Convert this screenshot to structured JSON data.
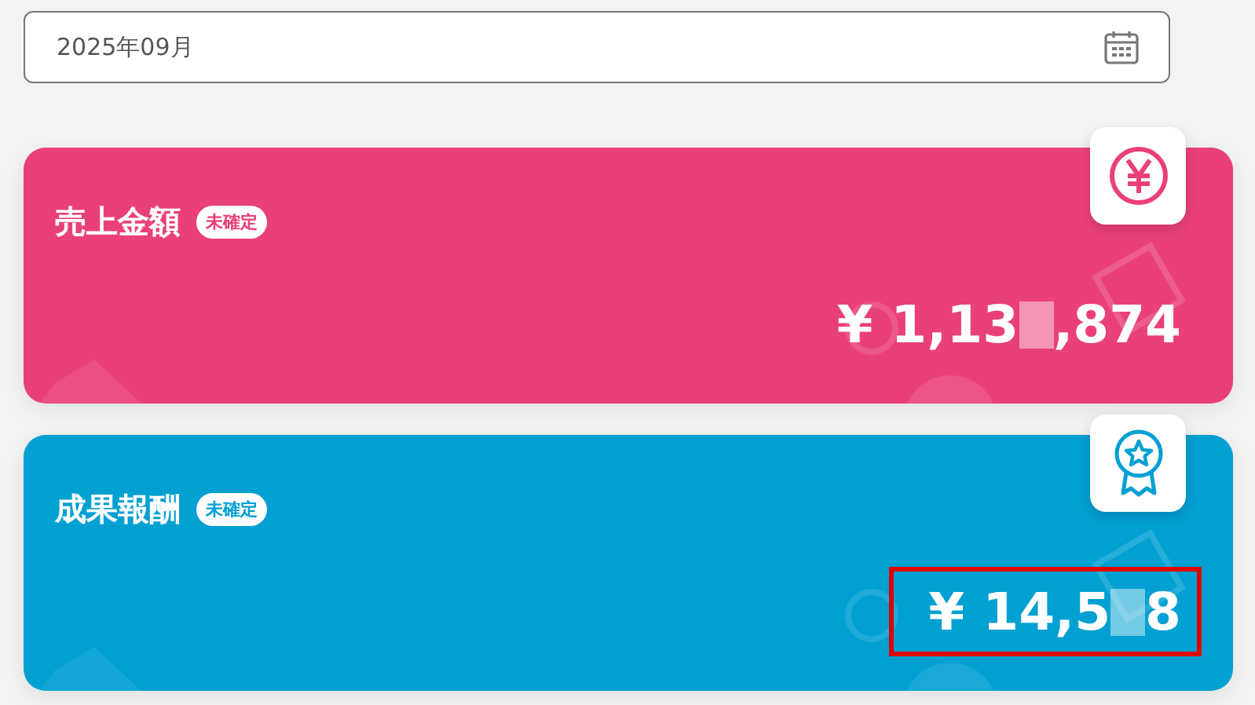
{
  "month_field": {
    "value": "2025年09月"
  },
  "cards": [
    {
      "title": "売上金額",
      "badge": "未確定",
      "kind": "yen",
      "color": "#ea4079",
      "amount_parts": [
        "¥ 1,13",
        ",874"
      ],
      "highlighted": false
    },
    {
      "title": "成果報酬",
      "badge": "未確定",
      "kind": "medal",
      "color": "#00a0d2",
      "amount_parts": [
        "¥ 14,5",
        "8"
      ],
      "highlighted": true
    }
  ]
}
